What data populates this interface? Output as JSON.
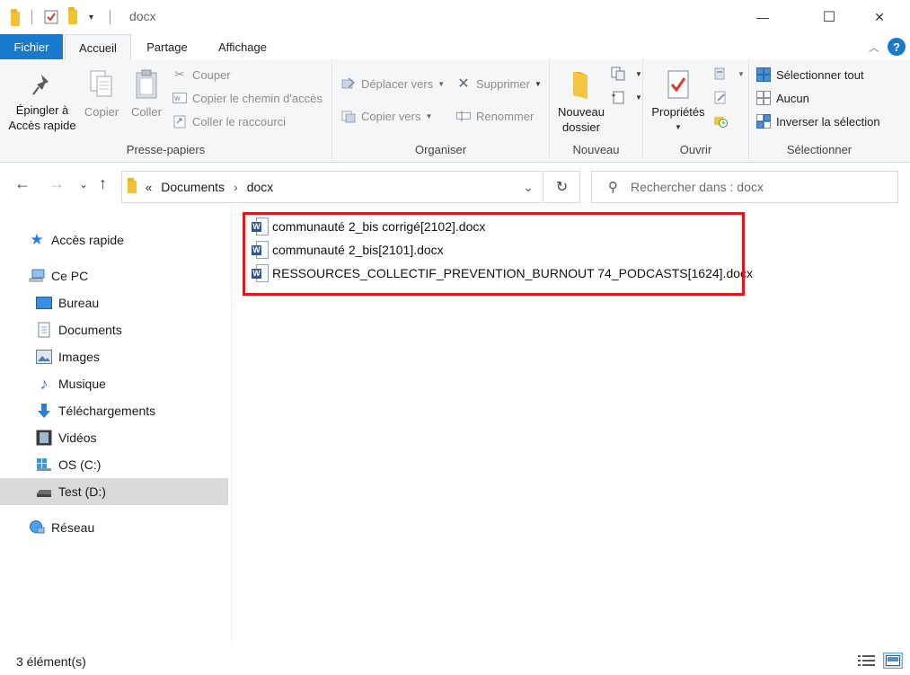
{
  "window": {
    "title": "docx",
    "minimize_glyph": "—",
    "maximize_glyph": "☐",
    "close_glyph": "✕"
  },
  "ribbon_tabs": [
    {
      "label": "Fichier"
    },
    {
      "label": "Accueil"
    },
    {
      "label": "Partage"
    },
    {
      "label": "Affichage"
    }
  ],
  "ribbon": {
    "clipboard": {
      "pin_label_1": "Épingler à",
      "pin_label_2": "Accès rapide",
      "copy": "Copier",
      "paste": "Coller",
      "cut": "Couper",
      "copy_path": "Copier le chemin d'accès",
      "paste_shortcut": "Coller le raccourci",
      "group": "Presse-papiers"
    },
    "organize": {
      "move_to": "Déplacer vers",
      "copy_to": "Copier vers",
      "delete": "Supprimer",
      "rename": "Renommer",
      "group": "Organiser"
    },
    "new": {
      "new_folder_1": "Nouveau",
      "new_folder_2": "dossier",
      "group": "Nouveau"
    },
    "open": {
      "properties": "Propriétés",
      "group": "Ouvrir"
    },
    "select": {
      "select_all": "Sélectionner tout",
      "select_none": "Aucun",
      "invert": "Inverser la sélection",
      "group": "Sélectionner"
    }
  },
  "address": {
    "prefix": "«",
    "crumbs": [
      {
        "label": "Documents"
      },
      {
        "label": "docx"
      }
    ],
    "separator": "›"
  },
  "search": {
    "placeholder": "Rechercher dans : docx"
  },
  "nav_pane": {
    "items": [
      {
        "label": "Accès rapide"
      },
      {
        "label": "Ce PC"
      },
      {
        "label": "Bureau"
      },
      {
        "label": "Documents"
      },
      {
        "label": "Images"
      },
      {
        "label": "Musique"
      },
      {
        "label": "Téléchargements"
      },
      {
        "label": "Vidéos"
      },
      {
        "label": "OS (C:)"
      },
      {
        "label": "Test (D:)"
      },
      {
        "label": "Réseau"
      }
    ]
  },
  "files": [
    {
      "name": "communauté 2_bis corrigé[2102].docx"
    },
    {
      "name": "communauté 2_bis[2101].docx"
    },
    {
      "name": "RESSOURCES_COLLECTIF_PREVENTION_BURNOUT 74_PODCASTS[1624].docx"
    }
  ],
  "status": {
    "count": "3 élément(s)"
  },
  "colors": {
    "accent": "#1979ca",
    "highlight": "#e8141c",
    "selected_nav": "#d9d9d9"
  }
}
